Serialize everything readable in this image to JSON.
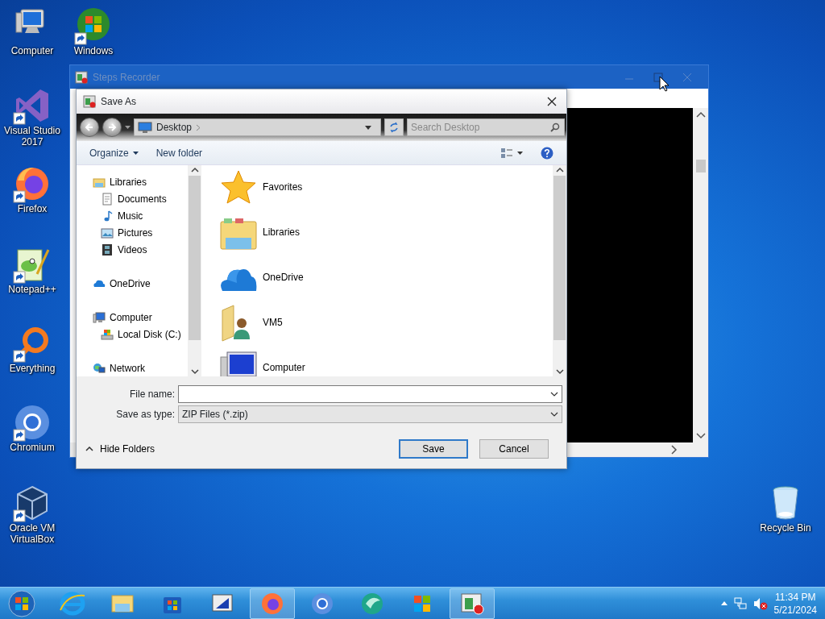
{
  "desktop_icons": [
    {
      "label": "Computer",
      "kind": "computer",
      "shortcut": false
    },
    {
      "label": "Windows",
      "kind": "media-center",
      "shortcut": true
    },
    {
      "label": "Visual Studio 2017",
      "kind": "visual-studio",
      "shortcut": true
    },
    {
      "label": "Firefox",
      "kind": "firefox",
      "shortcut": true
    },
    {
      "label": "Notepad++",
      "kind": "notepad",
      "shortcut": true
    },
    {
      "label": "Everything",
      "kind": "everything",
      "shortcut": true
    },
    {
      "label": "Chromium",
      "kind": "chromium",
      "shortcut": true
    },
    {
      "label": "Oracle VM VirtualBox",
      "kind": "virtualbox",
      "shortcut": true
    },
    {
      "label": "Recycle Bin",
      "kind": "recycle-bin",
      "shortcut": false
    }
  ],
  "steps_recorder": {
    "title": "Steps Recorder"
  },
  "save_dialog": {
    "title": "Save As",
    "address": {
      "location": "Desktop",
      "search_placeholder": "Search Desktop"
    },
    "toolbar": {
      "organize": "Organize",
      "new_folder": "New folder"
    },
    "nav_tree": [
      {
        "label": "Libraries",
        "kind": "libraries",
        "children": [
          {
            "label": "Documents",
            "kind": "documents"
          },
          {
            "label": "Music",
            "kind": "music"
          },
          {
            "label": "Pictures",
            "kind": "pictures"
          },
          {
            "label": "Videos",
            "kind": "videos"
          }
        ]
      },
      {
        "label": "OneDrive",
        "kind": "onedrive"
      },
      {
        "label": "Computer",
        "kind": "computer",
        "children": [
          {
            "label": "Local Disk (C:)",
            "kind": "disk"
          }
        ]
      },
      {
        "label": "Network",
        "kind": "network"
      }
    ],
    "items": [
      {
        "label": "Favorites",
        "kind": "favorites"
      },
      {
        "label": "Libraries",
        "kind": "libraries"
      },
      {
        "label": "OneDrive",
        "kind": "onedrive"
      },
      {
        "label": "VM5",
        "kind": "user-folder"
      },
      {
        "label": "Computer",
        "kind": "computer"
      }
    ],
    "file_name": {
      "label": "File name:"
    },
    "save_type": {
      "label": "Save as type:",
      "value": "ZIP Files (*.zip)"
    },
    "hide_folders": "Hide Folders",
    "buttons": [
      {
        "label": "Save",
        "default": true
      },
      {
        "label": "Cancel",
        "default": false
      }
    ]
  },
  "taskbar": {
    "apps": [
      {
        "kind": "internet-explorer",
        "running": false
      },
      {
        "kind": "file-explorer",
        "running": false
      },
      {
        "kind": "store",
        "running": false
      },
      {
        "kind": "monitor-app",
        "running": false
      },
      {
        "kind": "firefox",
        "running": true
      },
      {
        "kind": "chromium",
        "running": false
      },
      {
        "kind": "green-app",
        "running": false
      },
      {
        "kind": "media-center",
        "running": false
      },
      {
        "kind": "steps-recorder",
        "running": true
      }
    ],
    "time": "11:34 PM",
    "date": "5/21/2024"
  }
}
